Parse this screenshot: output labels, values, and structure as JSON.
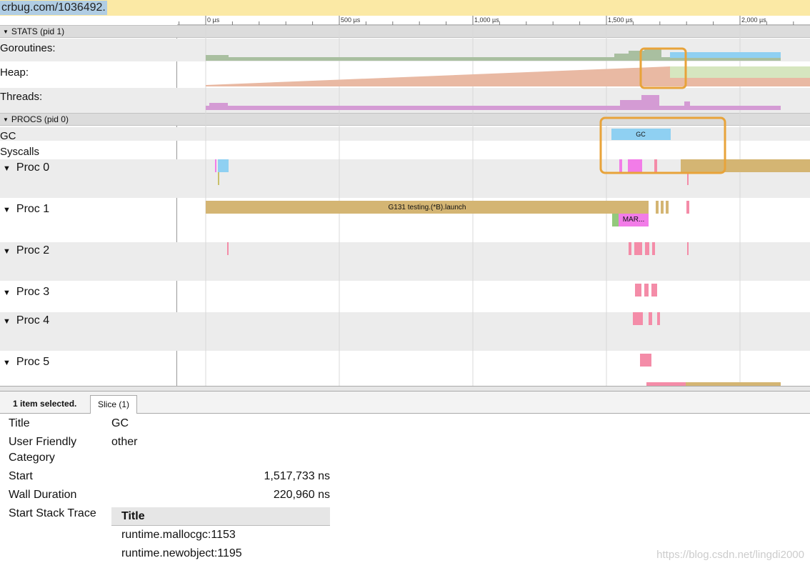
{
  "url_bar": {
    "text": "crbug.com/1036492."
  },
  "ruler": {
    "ticks": [
      "0 µs",
      "500 µs",
      "1,000 µs",
      "1,500 µs",
      "2,000 µs"
    ]
  },
  "stats_group": {
    "header": "STATS (pid 1)",
    "rows": [
      {
        "label": "Goroutines:"
      },
      {
        "label": "Heap:"
      },
      {
        "label": "Threads:"
      }
    ]
  },
  "procs_group": {
    "header": "PROCS (pid 0)",
    "gc_label": "GC",
    "syscalls_label": "Syscalls",
    "procs": [
      {
        "label": "Proc 0"
      },
      {
        "label": "Proc 1"
      },
      {
        "label": "Proc 2"
      },
      {
        "label": "Proc 3"
      },
      {
        "label": "Proc 4"
      },
      {
        "label": "Proc 5"
      }
    ]
  },
  "slices": {
    "gc_slice": "GC",
    "launch_slice": "G131 testing.(*B).launch",
    "mar_slice": "MAR..."
  },
  "colors": {
    "goroutines": "#a9bfa0",
    "heap_used": "#e9b9a3",
    "heap_free": "#d6e6bf",
    "threads": "#d49bd4",
    "gc": "#8fd0f2",
    "launch": "#d4b573",
    "pink": "#f48ca8",
    "magenta": "#f27ce8",
    "highlight": "#e8a33a"
  },
  "detail_panel": {
    "selection_count": "1 item selected.",
    "tab_label": "Slice (1)",
    "title_label": "Title",
    "title_value": "GC",
    "category_label_1": "User Friendly",
    "category_label_2": "Category",
    "category_value": "other",
    "start_label": "Start",
    "start_value": "1,517,733 ns",
    "duration_label": "Wall Duration",
    "duration_value": "220,960 ns",
    "stack_label": "Start Stack Trace",
    "stack_header": "Title",
    "stack_frames": [
      "runtime.mallocgc:1153",
      "runtime.newobject:1195"
    ]
  },
  "watermark": "https://blog.csdn.net/lingdi2000"
}
